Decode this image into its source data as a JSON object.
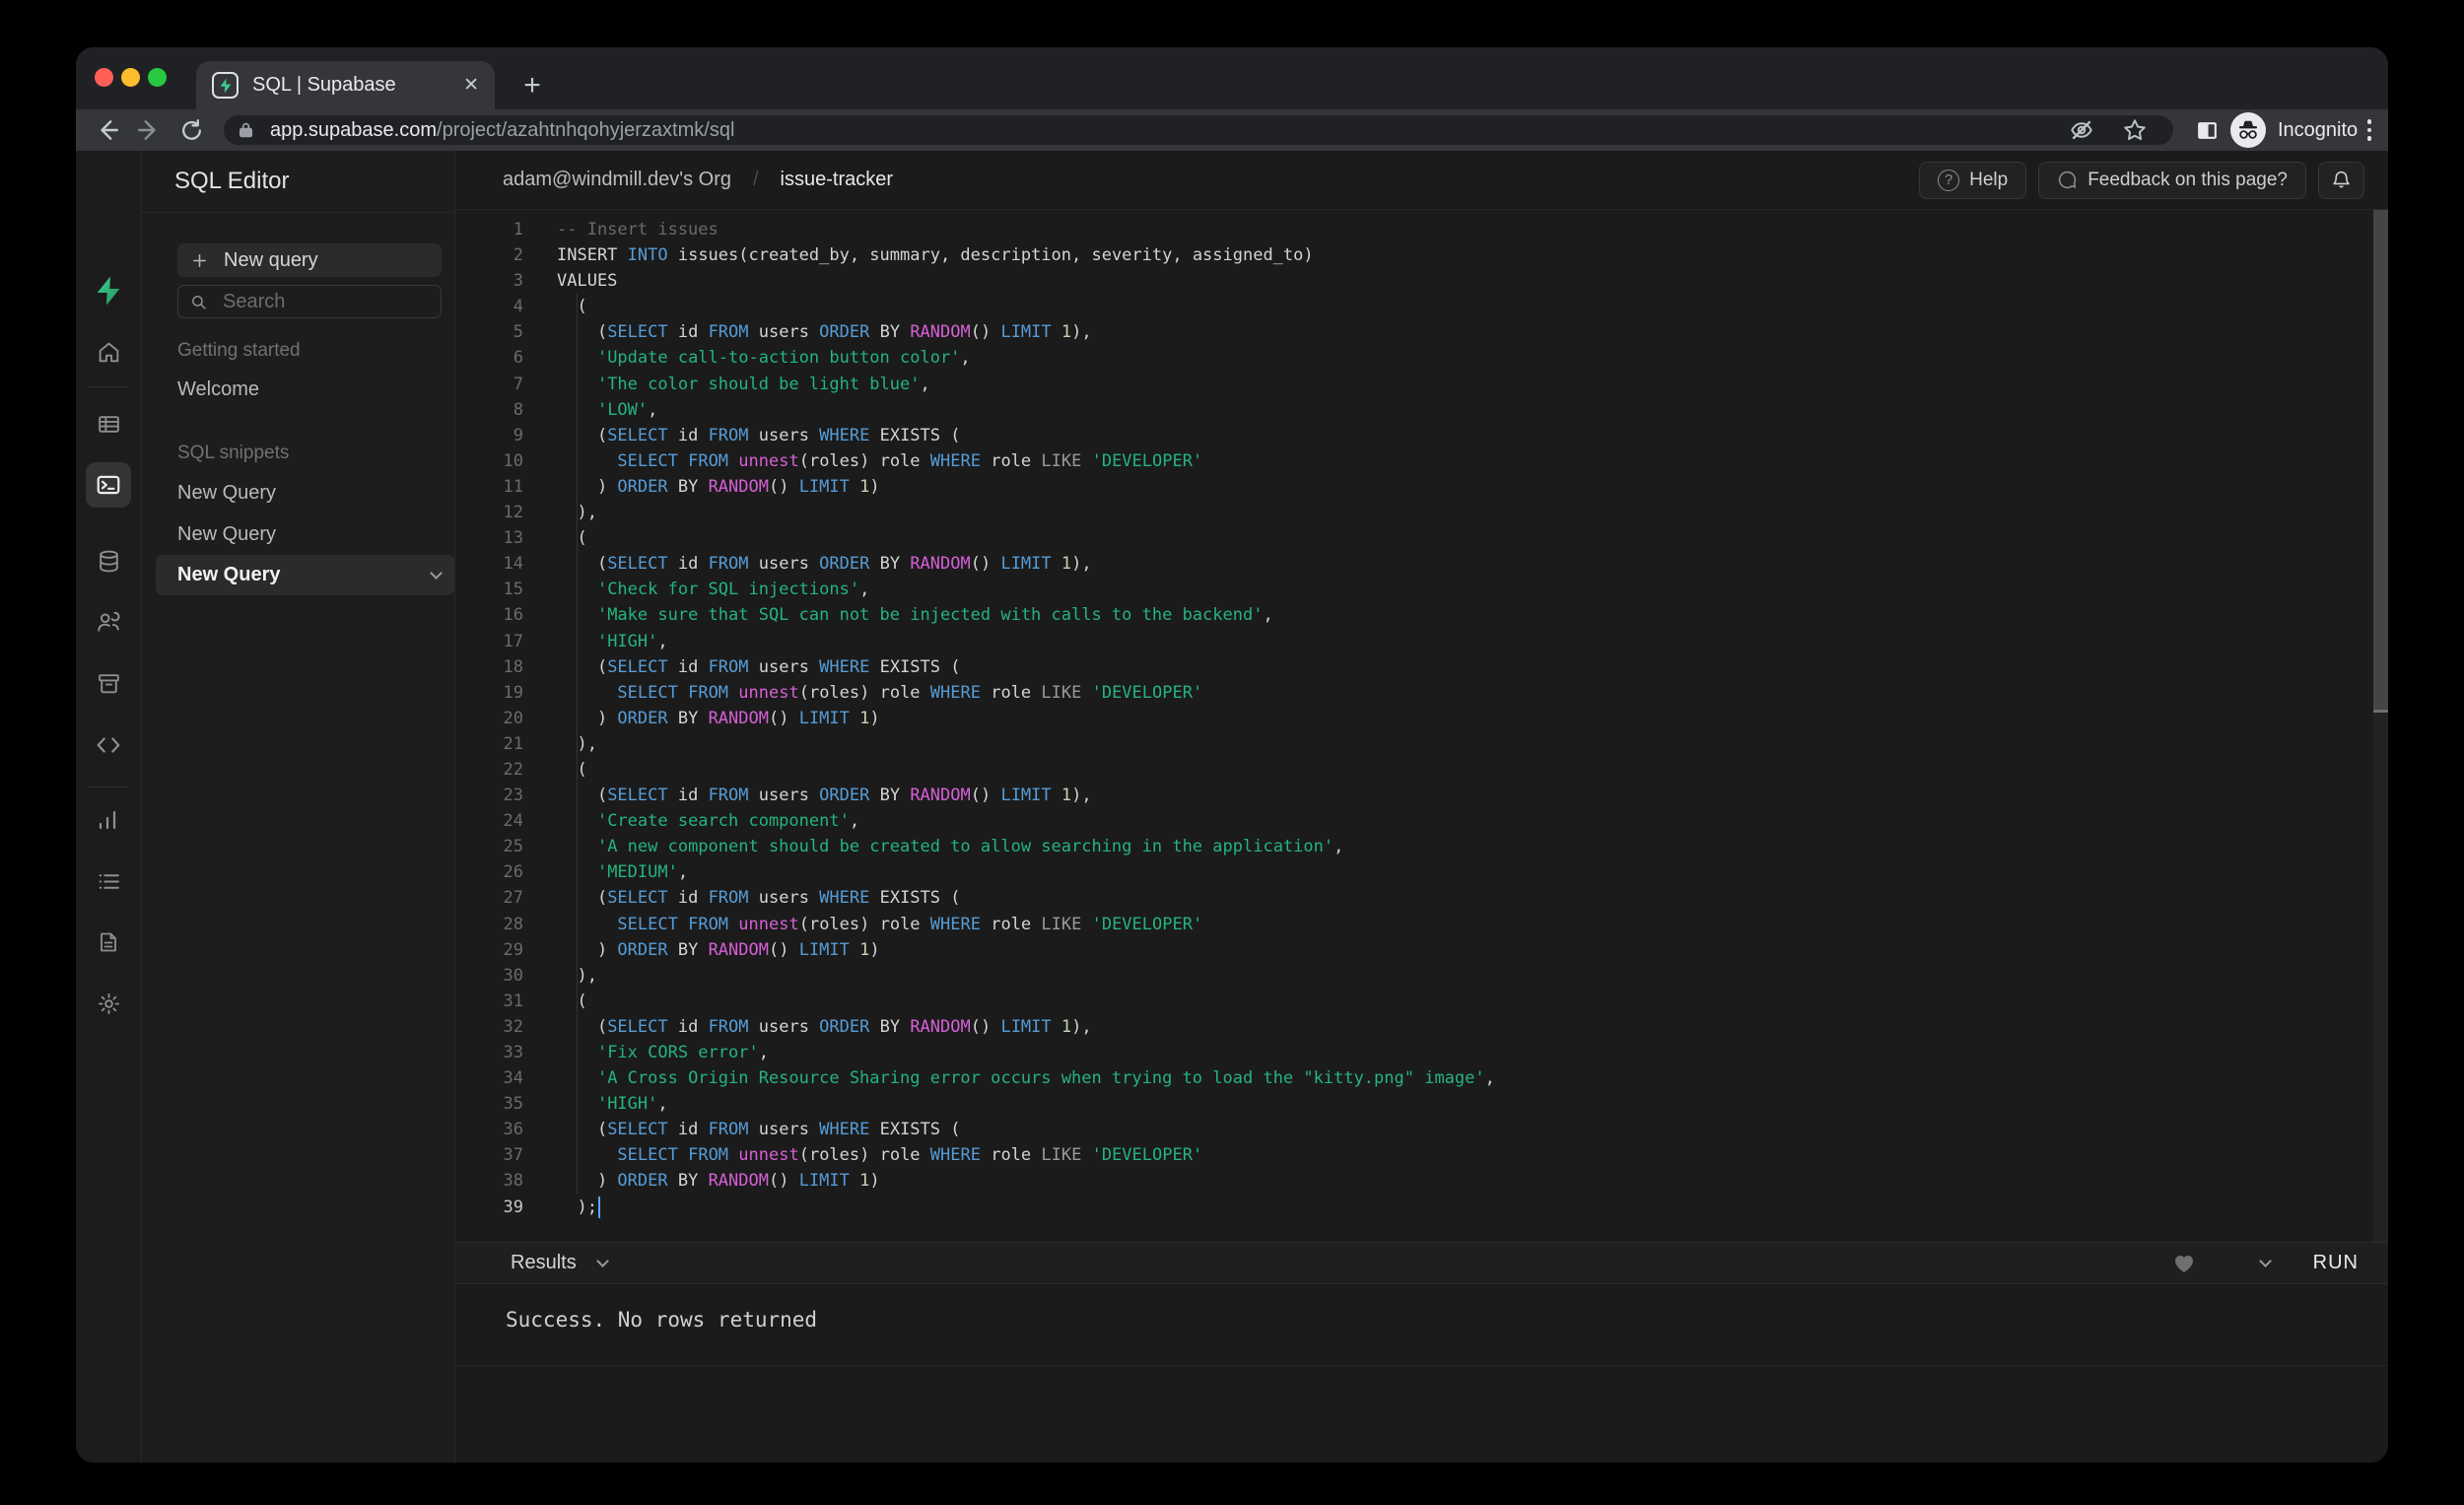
{
  "browser": {
    "tab_title": "SQL | Supabase",
    "url_host": "app.supabase.com",
    "url_path": "/project/azahtnhqohyjerzaxtmk/sql",
    "incognito_label": "Incognito",
    "glyphs": {
      "plus": "+",
      "close": "✕",
      "question": "?"
    },
    "traffic_colors": {
      "close": "#ff5f57",
      "minimize": "#febc2e",
      "zoom": "#28c840"
    }
  },
  "app": {
    "rail_items": [
      "home",
      "table-editor",
      "sql-editor",
      "database",
      "authentication",
      "storage",
      "edge-functions",
      "reports",
      "logs",
      "docs",
      "settings",
      "account"
    ],
    "rail_active": "sql-editor",
    "sidebar": {
      "title": "SQL Editor",
      "new_query_button": "New query",
      "search_placeholder": "Search",
      "sections": [
        {
          "label": "Getting started",
          "items": [
            {
              "label": "Welcome",
              "active": false
            }
          ]
        },
        {
          "label": "SQL snippets",
          "items": [
            {
              "label": "New Query",
              "active": false
            },
            {
              "label": "New Query",
              "active": false
            },
            {
              "label": "New Query",
              "active": true
            }
          ]
        }
      ]
    },
    "header": {
      "org": "adam@windmill.dev's Org",
      "separator": "/",
      "project": "issue-tracker",
      "help_label": "Help",
      "feedback_label": "Feedback on this page?"
    },
    "editor": {
      "cursor_line": 39,
      "token_legend": {
        "c": "comment",
        "k": "keyword",
        "f": "function",
        "s": "string",
        "n": "number",
        "o": "operator",
        "d": "default"
      },
      "lines": [
        [
          [
            "c",
            "-- Insert issues"
          ]
        ],
        [
          [
            "d",
            "INSERT "
          ],
          [
            "k",
            "INTO"
          ],
          [
            "d",
            " issues(created_by, summary, description, severity, assigned_to)"
          ]
        ],
        [
          [
            "d",
            "VALUES"
          ]
        ],
        [
          [
            "d",
            "  ("
          ]
        ],
        [
          [
            "d",
            "    ("
          ],
          [
            "k",
            "SELECT"
          ],
          [
            "d",
            " id "
          ],
          [
            "k",
            "FROM"
          ],
          [
            "d",
            " users "
          ],
          [
            "k",
            "ORDER"
          ],
          [
            "d",
            " BY "
          ],
          [
            "f",
            "RANDOM"
          ],
          [
            "d",
            "() "
          ],
          [
            "k",
            "LIMIT"
          ],
          [
            "d",
            " "
          ],
          [
            "n",
            "1"
          ],
          [
            "d",
            "),"
          ]
        ],
        [
          [
            "d",
            "    "
          ],
          [
            "s",
            "'Update call-to-action button color'"
          ],
          [
            "d",
            ","
          ]
        ],
        [
          [
            "d",
            "    "
          ],
          [
            "s",
            "'The color should be light blue'"
          ],
          [
            "d",
            ","
          ]
        ],
        [
          [
            "d",
            "    "
          ],
          [
            "s",
            "'LOW'"
          ],
          [
            "d",
            ","
          ]
        ],
        [
          [
            "d",
            "    ("
          ],
          [
            "k",
            "SELECT"
          ],
          [
            "d",
            " id "
          ],
          [
            "k",
            "FROM"
          ],
          [
            "d",
            " users "
          ],
          [
            "k",
            "WHERE"
          ],
          [
            "d",
            " EXISTS ("
          ]
        ],
        [
          [
            "d",
            "      "
          ],
          [
            "k",
            "SELECT"
          ],
          [
            "d",
            " "
          ],
          [
            "k",
            "FROM"
          ],
          [
            "d",
            " "
          ],
          [
            "f",
            "unnest"
          ],
          [
            "d",
            "(roles) role "
          ],
          [
            "k",
            "WHERE"
          ],
          [
            "d",
            " role "
          ],
          [
            "o",
            "LIKE"
          ],
          [
            "d",
            " "
          ],
          [
            "s",
            "'DEVELOPER'"
          ]
        ],
        [
          [
            "d",
            "    ) "
          ],
          [
            "k",
            "ORDER"
          ],
          [
            "d",
            " BY "
          ],
          [
            "f",
            "RANDOM"
          ],
          [
            "d",
            "() "
          ],
          [
            "k",
            "LIMIT"
          ],
          [
            "d",
            " "
          ],
          [
            "n",
            "1"
          ],
          [
            "d",
            ")"
          ]
        ],
        [
          [
            "d",
            "  ),"
          ]
        ],
        [
          [
            "d",
            "  ("
          ]
        ],
        [
          [
            "d",
            "    ("
          ],
          [
            "k",
            "SELECT"
          ],
          [
            "d",
            " id "
          ],
          [
            "k",
            "FROM"
          ],
          [
            "d",
            " users "
          ],
          [
            "k",
            "ORDER"
          ],
          [
            "d",
            " BY "
          ],
          [
            "f",
            "RANDOM"
          ],
          [
            "d",
            "() "
          ],
          [
            "k",
            "LIMIT"
          ],
          [
            "d",
            " "
          ],
          [
            "n",
            "1"
          ],
          [
            "d",
            "),"
          ]
        ],
        [
          [
            "d",
            "    "
          ],
          [
            "s",
            "'Check for SQL injections'"
          ],
          [
            "d",
            ","
          ]
        ],
        [
          [
            "d",
            "    "
          ],
          [
            "s",
            "'Make sure that SQL can not be injected with calls to the backend'"
          ],
          [
            "d",
            ","
          ]
        ],
        [
          [
            "d",
            "    "
          ],
          [
            "s",
            "'HIGH'"
          ],
          [
            "d",
            ","
          ]
        ],
        [
          [
            "d",
            "    ("
          ],
          [
            "k",
            "SELECT"
          ],
          [
            "d",
            " id "
          ],
          [
            "k",
            "FROM"
          ],
          [
            "d",
            " users "
          ],
          [
            "k",
            "WHERE"
          ],
          [
            "d",
            " EXISTS ("
          ]
        ],
        [
          [
            "d",
            "      "
          ],
          [
            "k",
            "SELECT"
          ],
          [
            "d",
            " "
          ],
          [
            "k",
            "FROM"
          ],
          [
            "d",
            " "
          ],
          [
            "f",
            "unnest"
          ],
          [
            "d",
            "(roles) role "
          ],
          [
            "k",
            "WHERE"
          ],
          [
            "d",
            " role "
          ],
          [
            "o",
            "LIKE"
          ],
          [
            "d",
            " "
          ],
          [
            "s",
            "'DEVELOPER'"
          ]
        ],
        [
          [
            "d",
            "    ) "
          ],
          [
            "k",
            "ORDER"
          ],
          [
            "d",
            " BY "
          ],
          [
            "f",
            "RANDOM"
          ],
          [
            "d",
            "() "
          ],
          [
            "k",
            "LIMIT"
          ],
          [
            "d",
            " "
          ],
          [
            "n",
            "1"
          ],
          [
            "d",
            ")"
          ]
        ],
        [
          [
            "d",
            "  ),"
          ]
        ],
        [
          [
            "d",
            "  ("
          ]
        ],
        [
          [
            "d",
            "    ("
          ],
          [
            "k",
            "SELECT"
          ],
          [
            "d",
            " id "
          ],
          [
            "k",
            "FROM"
          ],
          [
            "d",
            " users "
          ],
          [
            "k",
            "ORDER"
          ],
          [
            "d",
            " BY "
          ],
          [
            "f",
            "RANDOM"
          ],
          [
            "d",
            "() "
          ],
          [
            "k",
            "LIMIT"
          ],
          [
            "d",
            " "
          ],
          [
            "n",
            "1"
          ],
          [
            "d",
            "),"
          ]
        ],
        [
          [
            "d",
            "    "
          ],
          [
            "s",
            "'Create search component'"
          ],
          [
            "d",
            ","
          ]
        ],
        [
          [
            "d",
            "    "
          ],
          [
            "s",
            "'A new component should be created to allow searching in the application'"
          ],
          [
            "d",
            ","
          ]
        ],
        [
          [
            "d",
            "    "
          ],
          [
            "s",
            "'MEDIUM'"
          ],
          [
            "d",
            ","
          ]
        ],
        [
          [
            "d",
            "    ("
          ],
          [
            "k",
            "SELECT"
          ],
          [
            "d",
            " id "
          ],
          [
            "k",
            "FROM"
          ],
          [
            "d",
            " users "
          ],
          [
            "k",
            "WHERE"
          ],
          [
            "d",
            " EXISTS ("
          ]
        ],
        [
          [
            "d",
            "      "
          ],
          [
            "k",
            "SELECT"
          ],
          [
            "d",
            " "
          ],
          [
            "k",
            "FROM"
          ],
          [
            "d",
            " "
          ],
          [
            "f",
            "unnest"
          ],
          [
            "d",
            "(roles) role "
          ],
          [
            "k",
            "WHERE"
          ],
          [
            "d",
            " role "
          ],
          [
            "o",
            "LIKE"
          ],
          [
            "d",
            " "
          ],
          [
            "s",
            "'DEVELOPER'"
          ]
        ],
        [
          [
            "d",
            "    ) "
          ],
          [
            "k",
            "ORDER"
          ],
          [
            "d",
            " BY "
          ],
          [
            "f",
            "RANDOM"
          ],
          [
            "d",
            "() "
          ],
          [
            "k",
            "LIMIT"
          ],
          [
            "d",
            " "
          ],
          [
            "n",
            "1"
          ],
          [
            "d",
            ")"
          ]
        ],
        [
          [
            "d",
            "  ),"
          ]
        ],
        [
          [
            "d",
            "  ("
          ]
        ],
        [
          [
            "d",
            "    ("
          ],
          [
            "k",
            "SELECT"
          ],
          [
            "d",
            " id "
          ],
          [
            "k",
            "FROM"
          ],
          [
            "d",
            " users "
          ],
          [
            "k",
            "ORDER"
          ],
          [
            "d",
            " BY "
          ],
          [
            "f",
            "RANDOM"
          ],
          [
            "d",
            "() "
          ],
          [
            "k",
            "LIMIT"
          ],
          [
            "d",
            " "
          ],
          [
            "n",
            "1"
          ],
          [
            "d",
            "),"
          ]
        ],
        [
          [
            "d",
            "    "
          ],
          [
            "s",
            "'Fix CORS error'"
          ],
          [
            "d",
            ","
          ]
        ],
        [
          [
            "d",
            "    "
          ],
          [
            "s",
            "'A Cross Origin Resource Sharing error occurs when trying to load the \"kitty.png\" image'"
          ],
          [
            "d",
            ","
          ]
        ],
        [
          [
            "d",
            "    "
          ],
          [
            "s",
            "'HIGH'"
          ],
          [
            "d",
            ","
          ]
        ],
        [
          [
            "d",
            "    ("
          ],
          [
            "k",
            "SELECT"
          ],
          [
            "d",
            " id "
          ],
          [
            "k",
            "FROM"
          ],
          [
            "d",
            " users "
          ],
          [
            "k",
            "WHERE"
          ],
          [
            "d",
            " EXISTS ("
          ]
        ],
        [
          [
            "d",
            "      "
          ],
          [
            "k",
            "SELECT"
          ],
          [
            "d",
            " "
          ],
          [
            "k",
            "FROM"
          ],
          [
            "d",
            " "
          ],
          [
            "f",
            "unnest"
          ],
          [
            "d",
            "(roles) role "
          ],
          [
            "k",
            "WHERE"
          ],
          [
            "d",
            " role "
          ],
          [
            "o",
            "LIKE"
          ],
          [
            "d",
            " "
          ],
          [
            "s",
            "'DEVELOPER'"
          ]
        ],
        [
          [
            "d",
            "    ) "
          ],
          [
            "k",
            "ORDER"
          ],
          [
            "d",
            " BY "
          ],
          [
            "f",
            "RANDOM"
          ],
          [
            "d",
            "() "
          ],
          [
            "k",
            "LIMIT"
          ],
          [
            "d",
            " "
          ],
          [
            "n",
            "1"
          ],
          [
            "d",
            ")"
          ]
        ],
        [
          [
            "d",
            "  );"
          ]
        ]
      ]
    },
    "results": {
      "label": "Results",
      "run_label": "RUN",
      "message": "Success. No rows returned"
    },
    "colors": {
      "brand_green": "#3ecf8e",
      "keyword": "#569cd6",
      "function": "#d75fd7",
      "string": "#24b47e",
      "comment": "#6a6a6a",
      "background": "#1b1b1b"
    }
  }
}
